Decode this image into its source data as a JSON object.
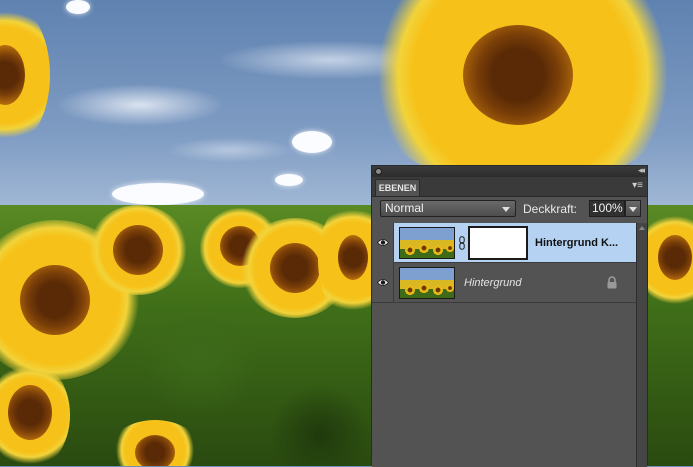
{
  "panel": {
    "tab_label": "EBENEN",
    "blend_mode": "Normal",
    "opacity_label": "Deckkraft:",
    "opacity_value": "100%"
  },
  "layers": [
    {
      "name": "Hintergrund K...",
      "selected": true,
      "has_mask": true,
      "visible": true
    },
    {
      "name": "Hintergrund",
      "selected": false,
      "has_mask": false,
      "visible": true,
      "locked": true
    }
  ],
  "colors": {
    "panel_bg": "#535353",
    "selected_row": "#b5d2f2",
    "tab_bar": "#3a3a3a"
  }
}
